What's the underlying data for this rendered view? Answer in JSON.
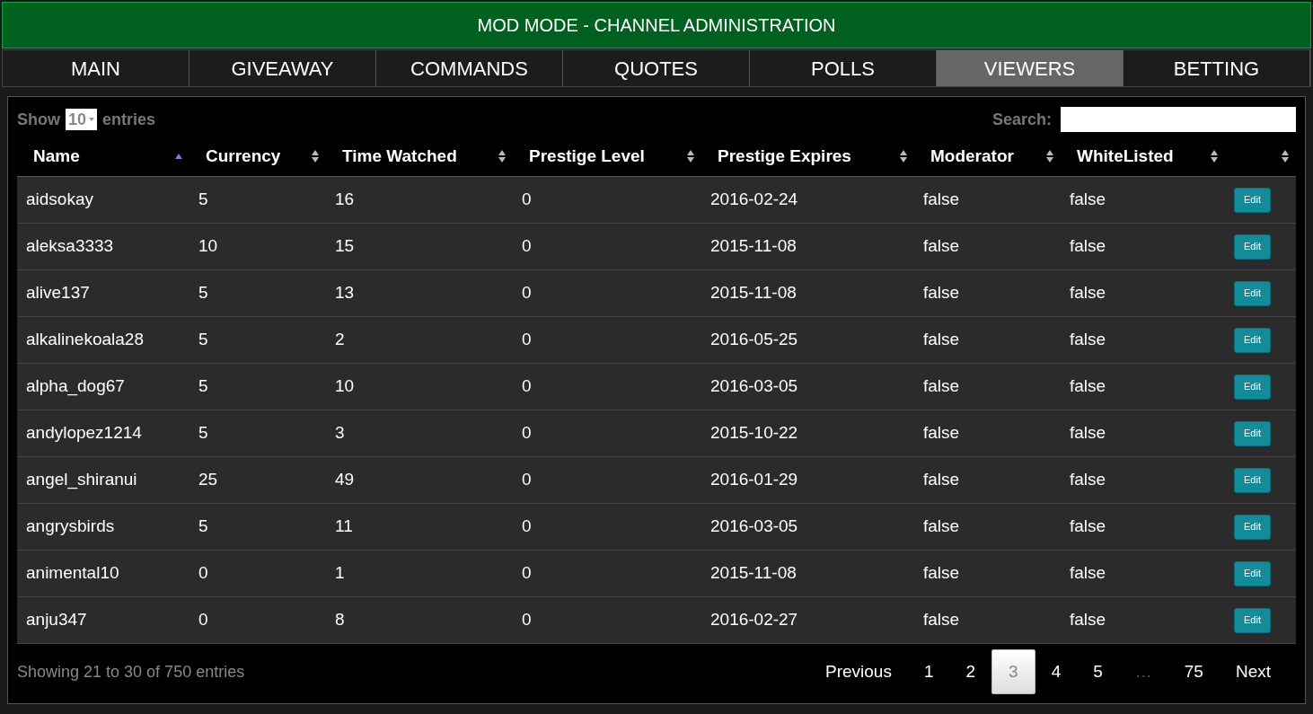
{
  "header": {
    "title": "MOD MODE - CHANNEL ADMINISTRATION"
  },
  "tabs": [
    {
      "label": "MAIN",
      "selected": false
    },
    {
      "label": "GIVEAWAY",
      "selected": false
    },
    {
      "label": "COMMANDS",
      "selected": false
    },
    {
      "label": "QUOTES",
      "selected": false
    },
    {
      "label": "POLLS",
      "selected": false
    },
    {
      "label": "VIEWERS",
      "selected": true
    },
    {
      "label": "BETTING",
      "selected": false
    }
  ],
  "length_control": {
    "prefix": "Show",
    "value": "10",
    "suffix": "entries"
  },
  "search": {
    "label": "Search:"
  },
  "table": {
    "columns": [
      {
        "label": "Name",
        "sorted": true
      },
      {
        "label": "Currency",
        "sorted": false
      },
      {
        "label": "Time Watched",
        "sorted": false
      },
      {
        "label": "Prestige Level",
        "sorted": false
      },
      {
        "label": "Prestige Expires",
        "sorted": false
      },
      {
        "label": "Moderator",
        "sorted": false
      },
      {
        "label": "WhiteListed",
        "sorted": false
      },
      {
        "sorted": false
      }
    ],
    "rows": [
      {
        "cells": [
          "aidsokay",
          "5",
          "16",
          "0",
          "2016-02-24",
          "false",
          "false"
        ],
        "action": "Edit"
      },
      {
        "cells": [
          "aleksa3333",
          "10",
          "15",
          "0",
          "2015-11-08",
          "false",
          "false"
        ],
        "action": "Edit"
      },
      {
        "cells": [
          "alive137",
          "5",
          "13",
          "0",
          "2015-11-08",
          "false",
          "false"
        ],
        "action": "Edit"
      },
      {
        "cells": [
          "alkalinekoala28",
          "5",
          "2",
          "0",
          "2016-05-25",
          "false",
          "false"
        ],
        "action": "Edit"
      },
      {
        "cells": [
          "alpha_dog67",
          "5",
          "10",
          "0",
          "2016-03-05",
          "false",
          "false"
        ],
        "action": "Edit"
      },
      {
        "cells": [
          "andylopez1214",
          "5",
          "3",
          "0",
          "2015-10-22",
          "false",
          "false"
        ],
        "action": "Edit"
      },
      {
        "cells": [
          "angel_shiranui",
          "25",
          "49",
          "0",
          "2016-01-29",
          "false",
          "false"
        ],
        "action": "Edit"
      },
      {
        "cells": [
          "angrysbirds",
          "5",
          "11",
          "0",
          "2016-03-05",
          "false",
          "false"
        ],
        "action": "Edit"
      },
      {
        "cells": [
          "animental10",
          "0",
          "1",
          "0",
          "2015-11-08",
          "false",
          "false"
        ],
        "action": "Edit"
      },
      {
        "cells": [
          "anju347",
          "0",
          "8",
          "0",
          "2016-02-27",
          "false",
          "false"
        ],
        "action": "Edit"
      }
    ]
  },
  "info": "Showing 21 to 30 of 750 entries",
  "pagination": [
    {
      "kind": "nav",
      "label": "Previous"
    },
    {
      "kind": "page",
      "label": "1",
      "selected": false
    },
    {
      "kind": "page",
      "label": "2",
      "selected": false
    },
    {
      "kind": "page",
      "label": "3",
      "selected": true
    },
    {
      "kind": "page",
      "label": "4",
      "selected": false
    },
    {
      "kind": "page",
      "label": "5",
      "selected": false
    },
    {
      "kind": "ellipsis",
      "label": "…"
    },
    {
      "kind": "page",
      "label": "75",
      "selected": false
    },
    {
      "kind": "nav",
      "label": "Next"
    }
  ]
}
